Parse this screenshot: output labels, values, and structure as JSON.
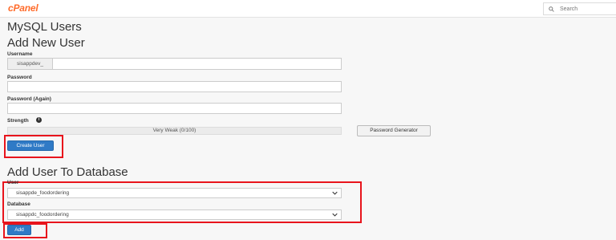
{
  "header": {
    "logo_text": "cPanel",
    "search_placeholder": "Search"
  },
  "page": {
    "title": "MySQL Users"
  },
  "add_user": {
    "title": "Add New User",
    "username_label": "Username",
    "username_prefix": "sisappdev_",
    "username_value": "",
    "password_label": "Password",
    "password_value": "",
    "password_again_label": "Password (Again)",
    "password_again_value": "",
    "strength_label": "Strength",
    "strength_text": "Very Weak (0/100)",
    "password_generator_label": "Password Generator",
    "create_button_label": "Create User"
  },
  "add_to_db": {
    "title": "Add User To Database",
    "user_label": "User",
    "user_selected": "sisappde_foodordering",
    "database_label": "Database",
    "database_selected": "sisappdc_foodordering",
    "add_button_label": "Add"
  },
  "colors": {
    "brand": "#ff6c2c",
    "primary_button": "#2f7ac6",
    "highlight": "#e8141c",
    "background": "#f7f7f7"
  },
  "icons": {
    "search": "search-icon",
    "info": "info-icon",
    "chevron": "chevron-down-icon"
  }
}
